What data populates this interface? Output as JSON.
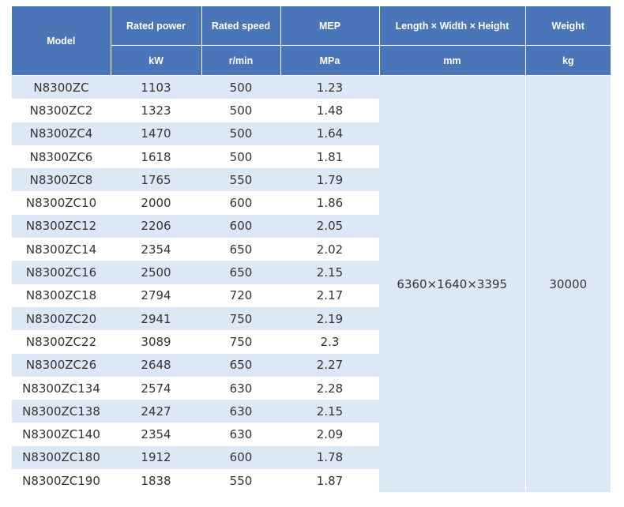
{
  "table": {
    "headers": {
      "model": "Model",
      "rated_power": "Rated power",
      "rated_speed": "Rated speed",
      "mep": "MEP",
      "dimensions": "Length × Width × Height",
      "weight": "Weight"
    },
    "units": {
      "rated_power": "kW",
      "rated_speed": "r/min",
      "mep": "MPa",
      "dimensions": "mm",
      "weight": "kg"
    },
    "shared": {
      "dimensions": "6360×1640×3395",
      "weight": "30000"
    },
    "rows": [
      [
        "N8300ZC",
        "1103",
        "500",
        "1.23"
      ],
      [
        "N8300ZC2",
        "1323",
        "500",
        "1.48"
      ],
      [
        "N8300ZC4",
        "1470",
        "500",
        "1.64"
      ],
      [
        "N8300ZC6",
        "1618",
        "500",
        "1.81"
      ],
      [
        "N8300ZC8",
        "1765",
        "550",
        "1.79"
      ],
      [
        "N8300ZC10",
        "2000",
        "600",
        "1.86"
      ],
      [
        "N8300ZC12",
        "2206",
        "600",
        "2.05"
      ],
      [
        "N8300ZC14",
        "2354",
        "650",
        "2.02"
      ],
      [
        "N8300ZC16",
        "2500",
        "650",
        "2.15"
      ],
      [
        "N8300ZC18",
        "2794",
        "720",
        "2.17"
      ],
      [
        "N8300ZC20",
        "2941",
        "750",
        "2.19"
      ],
      [
        "N8300ZC22",
        "3089",
        "750",
        "2.3"
      ],
      [
        "N8300ZC26",
        "2648",
        "650",
        "2.27"
      ],
      [
        "N8300ZC134",
        "2574",
        "630",
        "2.28"
      ],
      [
        "N8300ZC138",
        "2427",
        "630",
        "2.15"
      ],
      [
        "N8300ZC140",
        "2354",
        "630",
        "2.09"
      ],
      [
        "N8300ZC180",
        "1912",
        "600",
        "1.78"
      ],
      [
        "N8300ZC190",
        "1838",
        "550",
        "1.87"
      ]
    ]
  }
}
